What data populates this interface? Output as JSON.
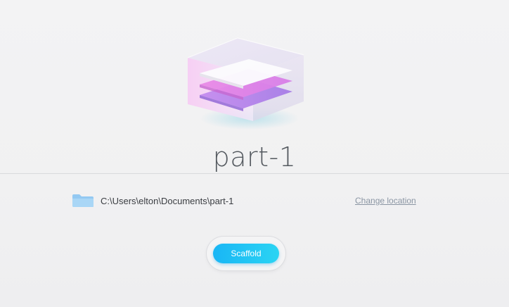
{
  "project": {
    "name": "part-1",
    "icon": "layered-box-icon"
  },
  "location": {
    "folder_icon": "folder-icon",
    "path": "C:\\Users\\elton\\Documents\\part-1",
    "change_label": "Change location"
  },
  "actions": {
    "scaffold_label": "Scaffold"
  },
  "colors": {
    "accent_start": "#19b6f5",
    "accent_end": "#2bd4f3",
    "link": "#8a95a3"
  }
}
